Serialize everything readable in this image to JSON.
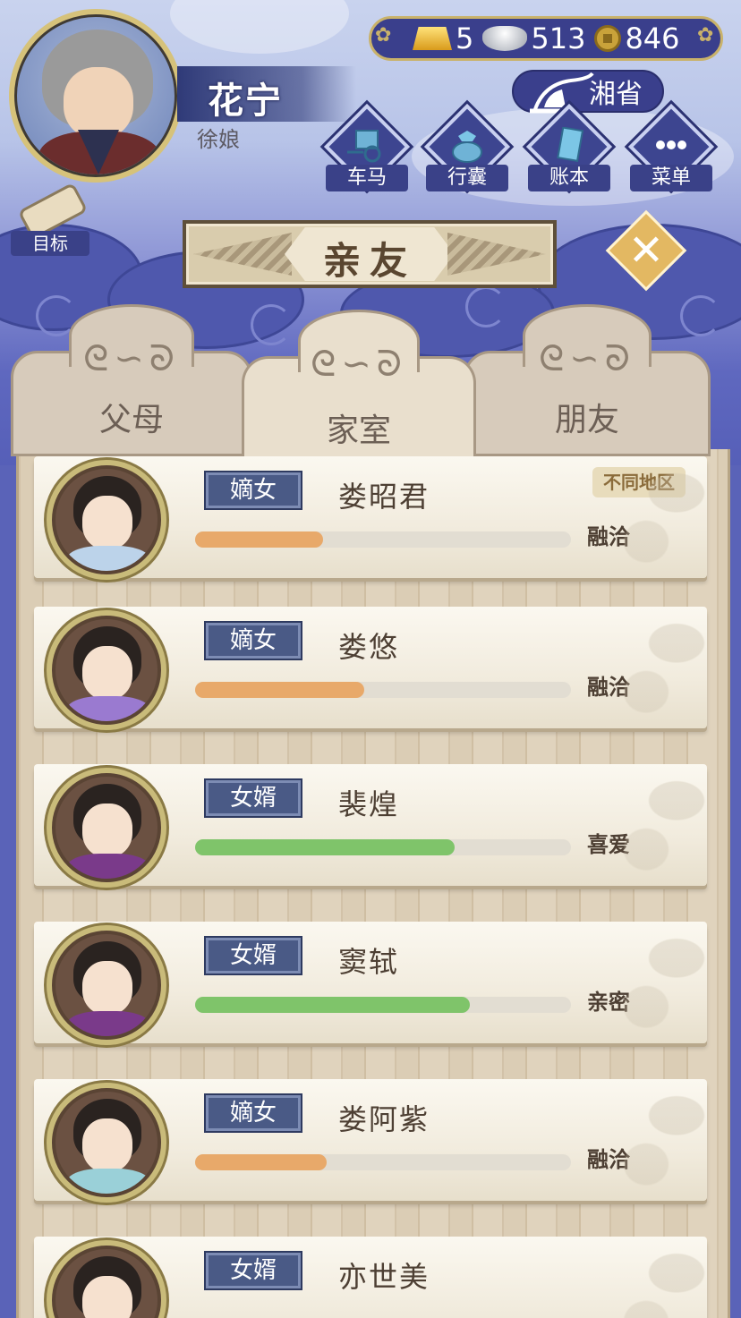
{
  "player": {
    "name": "花宁",
    "title": "徐娘"
  },
  "currency": {
    "gold": "5",
    "silver": "513",
    "copper": "846"
  },
  "location": "湘省",
  "menu": [
    {
      "label": "车马",
      "icon": "carriage-icon"
    },
    {
      "label": "行囊",
      "icon": "bundle-icon"
    },
    {
      "label": "账本",
      "icon": "ledger-icon"
    },
    {
      "label": "菜单",
      "icon": "more-icon"
    }
  ],
  "goal_label": "目标",
  "page_title": "亲友",
  "tabs": [
    {
      "label": "父母"
    },
    {
      "label": "家室",
      "active": true
    },
    {
      "label": "朋友"
    }
  ],
  "members": [
    {
      "tag": "嫡女",
      "name": "娄昭君",
      "relation": "融洽",
      "affinity": 0.34,
      "bar_color": "#e8a96a",
      "badge": "不同地区",
      "clothes": "#bcd3ea"
    },
    {
      "tag": "嫡女",
      "name": "娄悠",
      "relation": "融洽",
      "affinity": 0.45,
      "bar_color": "#e8a96a",
      "clothes": "#9a7ad0"
    },
    {
      "tag": "女婿",
      "name": "裴煌",
      "relation": "喜爱",
      "affinity": 0.69,
      "bar_color": "#7fc46a",
      "clothes": "#7a3a8a"
    },
    {
      "tag": "女婿",
      "name": "窦轼",
      "relation": "亲密",
      "affinity": 0.73,
      "bar_color": "#7fc46a",
      "clothes": "#7a3a8a"
    },
    {
      "tag": "嫡女",
      "name": "娄阿紫",
      "relation": "融洽",
      "affinity": 0.35,
      "bar_color": "#e8a96a",
      "clothes": "#9ad0d8"
    },
    {
      "tag": "女婿",
      "name": "亦世美",
      "relation": "",
      "affinity": null,
      "bar_color": "#7fc46a",
      "clothes": "#3a4a8a"
    }
  ]
}
